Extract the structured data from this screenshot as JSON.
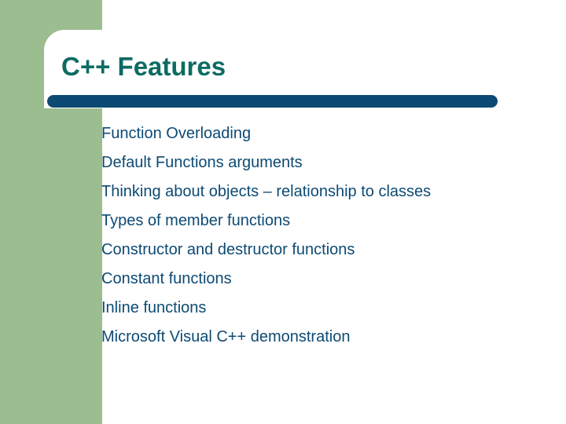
{
  "title": "C++ Features",
  "bullets": [
    "Function Overloading",
    "Default Functions arguments",
    "Thinking about objects – relationship to classes",
    "Types of member functions",
    "Constructor and destructor functions",
    "Constant functions",
    "Inline functions",
    "Microsoft Visual C++ demonstration"
  ]
}
